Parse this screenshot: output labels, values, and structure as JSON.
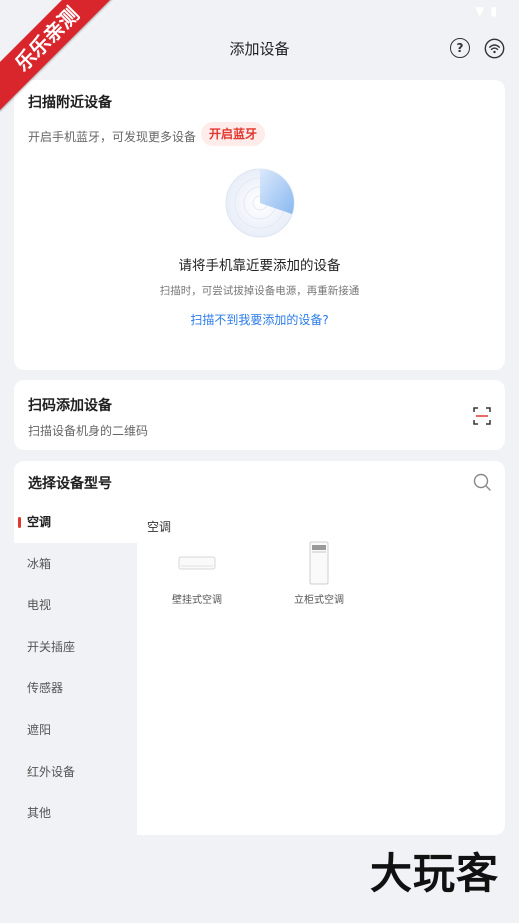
{
  "corner_badge": "乐乐亲测",
  "header": {
    "title": "添加设备",
    "help_glyph": "?"
  },
  "nearby": {
    "title": "扫描附近设备",
    "bluetooth_tip": "开启手机蓝牙，可发现更多设备",
    "bluetooth_button": "开启蓝牙",
    "scan_main": "请将手机靠近要添加的设备",
    "scan_tip": "扫描时，可尝试拔掉设备电源，再重新接通",
    "scan_link": "扫描不到我要添加的设备?"
  },
  "qrcode": {
    "title": "扫码添加设备",
    "subtitle": "扫描设备机身的二维码"
  },
  "model": {
    "title": "选择设备型号",
    "categories": [
      "空调",
      "冰箱",
      "电视",
      "开关插座",
      "传感器",
      "遮阳",
      "红外设备",
      "其他"
    ],
    "selected_index": 0,
    "category_title": "空调",
    "devices": [
      {
        "label": "壁挂式空调"
      },
      {
        "label": "立柜式空调"
      }
    ]
  },
  "watermark": "大玩客",
  "colors": {
    "accent": "#e2372f",
    "link": "#2b7be9",
    "background": "#f1f2f5"
  }
}
